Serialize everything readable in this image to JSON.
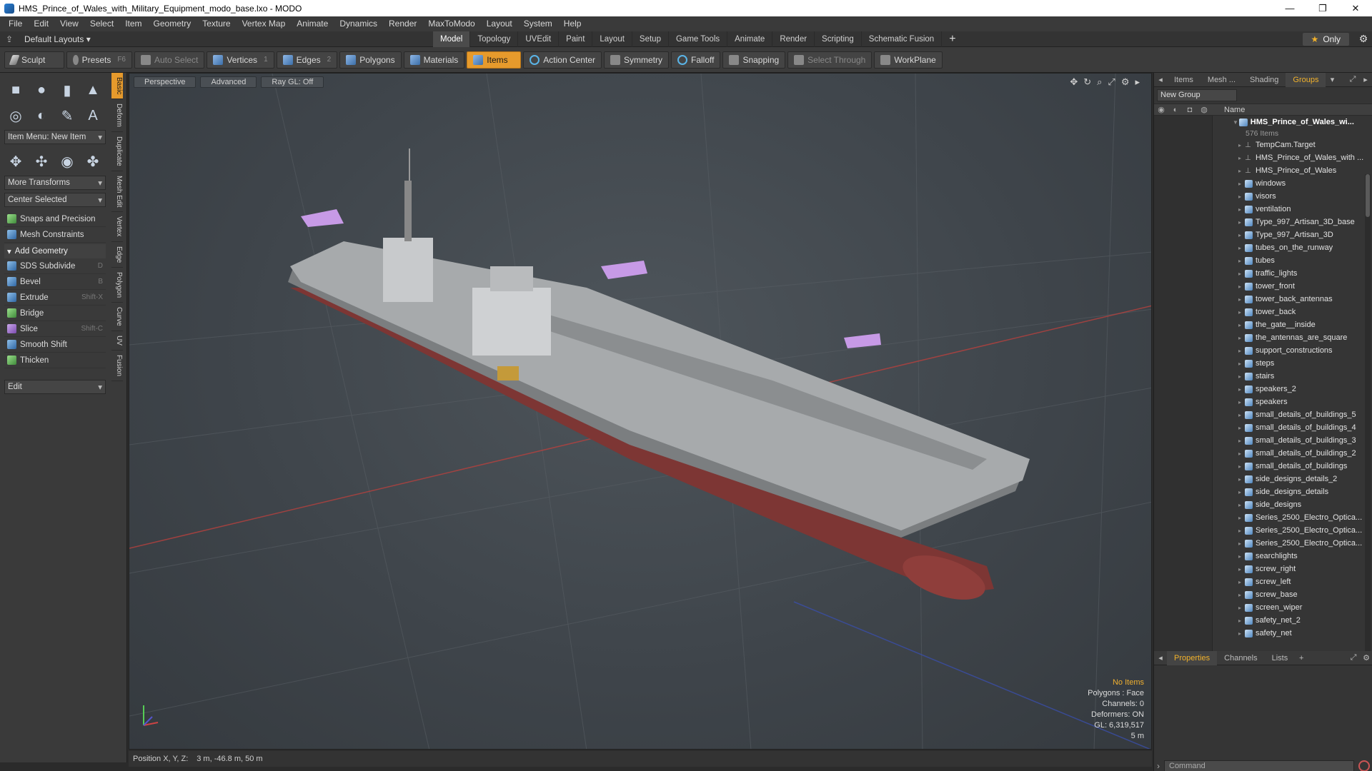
{
  "window": {
    "title": "HMS_Prince_of_Wales_with_Military_Equipment_modo_base.lxo - MODO",
    "controls": [
      "—",
      "❐",
      "✕"
    ]
  },
  "menu": [
    "File",
    "Edit",
    "View",
    "Select",
    "Item",
    "Geometry",
    "Texture",
    "Vertex Map",
    "Animate",
    "Dynamics",
    "Render",
    "MaxToModo",
    "Layout",
    "System",
    "Help"
  ],
  "layoutbar": {
    "dropdown": "Default Layouts ▾",
    "tabs": [
      "Model",
      "Topology",
      "UVEdit",
      "Paint",
      "Layout",
      "Setup",
      "Game Tools",
      "Animate",
      "Render",
      "Scripting",
      "Schematic Fusion"
    ],
    "active_tab": "Model",
    "only_label": "Only"
  },
  "toolbar": {
    "sculpt": "Sculpt",
    "presets": "Presets",
    "presets_hk": "F6",
    "auto_select": "Auto Select",
    "vertices": "Vertices",
    "vertices_hk": "1",
    "edges": "Edges",
    "edges_hk": "2",
    "polygons": "Polygons",
    "materials": "Materials",
    "items": "Items",
    "action_center": "Action Center",
    "symmetry": "Symmetry",
    "falloff": "Falloff",
    "snapping": "Snapping",
    "select_through": "Select Through",
    "workplane": "WorkPlane"
  },
  "toolbox": {
    "item_menu": "Item Menu: New Item",
    "more_transforms": "More Transforms",
    "center_selected": "Center Selected",
    "snaps": "Snaps and Precision",
    "mesh_constraints": "Mesh Constraints",
    "add_geometry": "Add Geometry",
    "tools": [
      {
        "label": "SDS Subdivide",
        "hk": "D"
      },
      {
        "label": "Bevel",
        "hk": "B"
      },
      {
        "label": "Extrude",
        "hk": "Shift-X"
      },
      {
        "label": "Bridge",
        "hk": ""
      },
      {
        "label": "Slice",
        "hk": "Shift-C"
      },
      {
        "label": "Smooth Shift",
        "hk": ""
      },
      {
        "label": "Thicken",
        "hk": ""
      }
    ],
    "edit": "Edit",
    "vtabs": [
      "Basic",
      "Deform",
      "Duplicate",
      "Mesh Edit",
      "Vertex",
      "Edge",
      "Polygon",
      "Curve",
      "UV",
      "Fusion"
    ]
  },
  "viewport": {
    "perspective": "Perspective",
    "advanced": "Advanced",
    "raygl": "Ray GL: Off",
    "info": {
      "no_items": "No Items",
      "polygons": "Polygons : Face",
      "channels": "Channels: 0",
      "deformers": "Deformers: ON",
      "gl": "GL: 6,319,517",
      "scale": "5 m"
    }
  },
  "statusbar": {
    "position_label": "Position X, Y, Z:",
    "position_value": "3 m, -46.8 m, 50 m"
  },
  "rightpanel": {
    "tabs": [
      "Items",
      "Mesh ...",
      "Shading",
      "Groups"
    ],
    "active_tab": "Groups",
    "new_group": "New Group",
    "name_header": "Name",
    "root": {
      "label": "HMS_Prince_of_Wales_wi...",
      "count": "576 Items"
    },
    "items": [
      {
        "label": "TempCam.Target",
        "kind": "locator"
      },
      {
        "label": "HMS_Prince_of_Wales_with ...",
        "kind": "locator"
      },
      {
        "label": "HMS_Prince_of_Wales",
        "kind": "locator"
      },
      {
        "label": "windows",
        "kind": "mesh"
      },
      {
        "label": "visors",
        "kind": "mesh"
      },
      {
        "label": "ventilation",
        "kind": "mesh"
      },
      {
        "label": "Type_997_Artisan_3D_base",
        "kind": "mesh"
      },
      {
        "label": "Type_997_Artisan_3D",
        "kind": "mesh"
      },
      {
        "label": "tubes_on_the_runway",
        "kind": "mesh"
      },
      {
        "label": "tubes",
        "kind": "mesh"
      },
      {
        "label": "traffic_lights",
        "kind": "mesh"
      },
      {
        "label": "tower_front",
        "kind": "mesh"
      },
      {
        "label": "tower_back_antennas",
        "kind": "mesh"
      },
      {
        "label": "tower_back",
        "kind": "mesh"
      },
      {
        "label": "the_gate__inside",
        "kind": "mesh"
      },
      {
        "label": "the_antennas_are_square",
        "kind": "mesh"
      },
      {
        "label": "support_constructions",
        "kind": "mesh"
      },
      {
        "label": "steps",
        "kind": "mesh"
      },
      {
        "label": "stairs",
        "kind": "mesh"
      },
      {
        "label": "speakers_2",
        "kind": "mesh"
      },
      {
        "label": "speakers",
        "kind": "mesh"
      },
      {
        "label": "small_details_of_buildings_5",
        "kind": "mesh"
      },
      {
        "label": "small_details_of_buildings_4",
        "kind": "mesh"
      },
      {
        "label": "small_details_of_buildings_3",
        "kind": "mesh"
      },
      {
        "label": "small_details_of_buildings_2",
        "kind": "mesh"
      },
      {
        "label": "small_details_of_buildings",
        "kind": "mesh"
      },
      {
        "label": "side_designs_details_2",
        "kind": "mesh"
      },
      {
        "label": "side_designs_details",
        "kind": "mesh"
      },
      {
        "label": "side_designs",
        "kind": "mesh"
      },
      {
        "label": "Series_2500_Electro_Optica...",
        "kind": "mesh"
      },
      {
        "label": "Series_2500_Electro_Optica...",
        "kind": "mesh"
      },
      {
        "label": "Series_2500_Electro_Optica...",
        "kind": "mesh"
      },
      {
        "label": "searchlights",
        "kind": "mesh"
      },
      {
        "label": "screw_right",
        "kind": "mesh"
      },
      {
        "label": "screw_left",
        "kind": "mesh"
      },
      {
        "label": "screw_base",
        "kind": "mesh"
      },
      {
        "label": "screen_wiper",
        "kind": "mesh"
      },
      {
        "label": "safety_net_2",
        "kind": "mesh"
      },
      {
        "label": "safety_net",
        "kind": "mesh"
      }
    ],
    "bottom_tabs": [
      "Properties",
      "Channels",
      "Lists"
    ],
    "bottom_active": "Properties",
    "command_placeholder": "Command"
  },
  "colors": {
    "accent": "#e69a2c",
    "tab_active_text": "#f2b22b",
    "hull_red": "#8a3a38",
    "deck_gray": "#9a9c9e"
  }
}
